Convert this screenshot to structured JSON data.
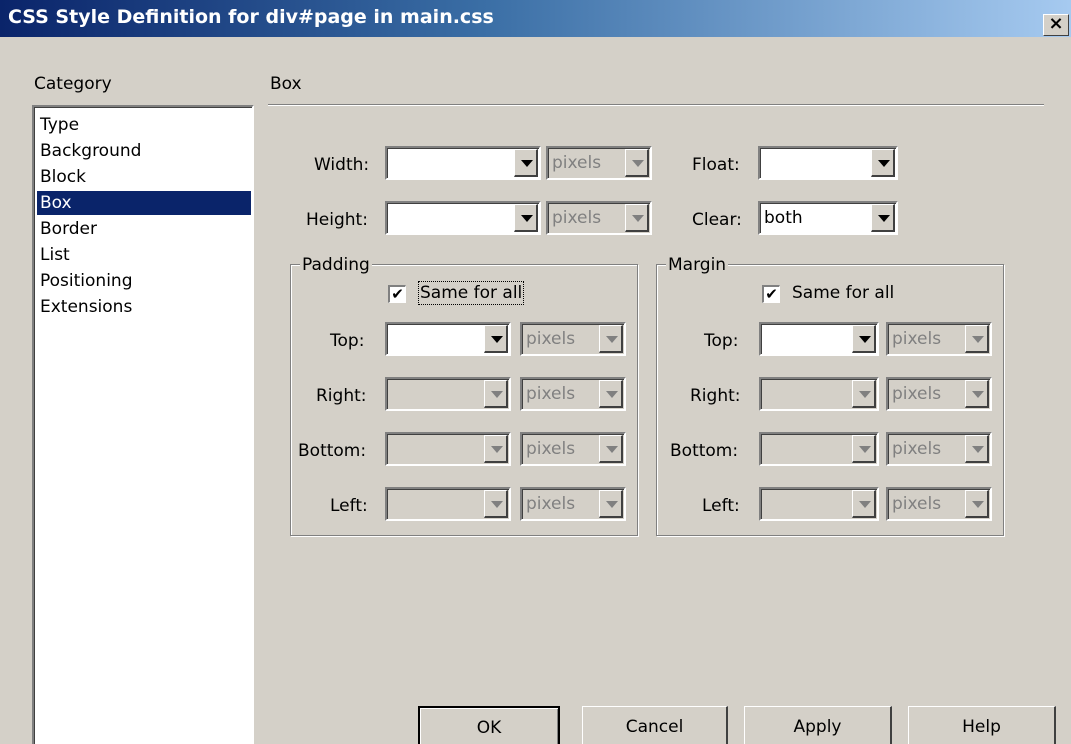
{
  "window": {
    "title": "CSS Style Definition for div#page in main.css",
    "close_label": "×"
  },
  "category": {
    "label": "Category",
    "items": [
      "Type",
      "Background",
      "Block",
      "Box",
      "Border",
      "List",
      "Positioning",
      "Extensions"
    ],
    "selected": "Box"
  },
  "panel": {
    "title": "Box",
    "width": {
      "label": "Width:",
      "value": "",
      "unit": "pixels"
    },
    "height": {
      "label": "Height:",
      "value": "",
      "unit": "pixels"
    },
    "float": {
      "label": "Float:",
      "value": ""
    },
    "clear": {
      "label": "Clear:",
      "value": "both"
    }
  },
  "padding": {
    "legend": "Padding",
    "same_for_all_label": "Same for all",
    "same_for_all_checked": true,
    "check_mark": "✔",
    "top": {
      "label": "Top:",
      "value": "",
      "unit": "pixels"
    },
    "right": {
      "label": "Right:",
      "value": "",
      "unit": "pixels"
    },
    "bottom": {
      "label": "Bottom:",
      "value": "",
      "unit": "pixels"
    },
    "left": {
      "label": "Left:",
      "value": "",
      "unit": "pixels"
    }
  },
  "margin": {
    "legend": "Margin",
    "same_for_all_label": "Same for all",
    "same_for_all_checked": true,
    "check_mark": "✔",
    "top": {
      "label": "Top:",
      "value": "",
      "unit": "pixels"
    },
    "right": {
      "label": "Right:",
      "value": "",
      "unit": "pixels"
    },
    "bottom": {
      "label": "Bottom:",
      "value": "",
      "unit": "pixels"
    },
    "left": {
      "label": "Left:",
      "value": "",
      "unit": "pixels"
    }
  },
  "buttons": {
    "ok": "OK",
    "cancel": "Cancel",
    "apply": "Apply",
    "help": "Help"
  },
  "icons": {
    "dropdown": "chevron-down-icon",
    "close": "close-icon",
    "check": "checkmark-icon"
  }
}
